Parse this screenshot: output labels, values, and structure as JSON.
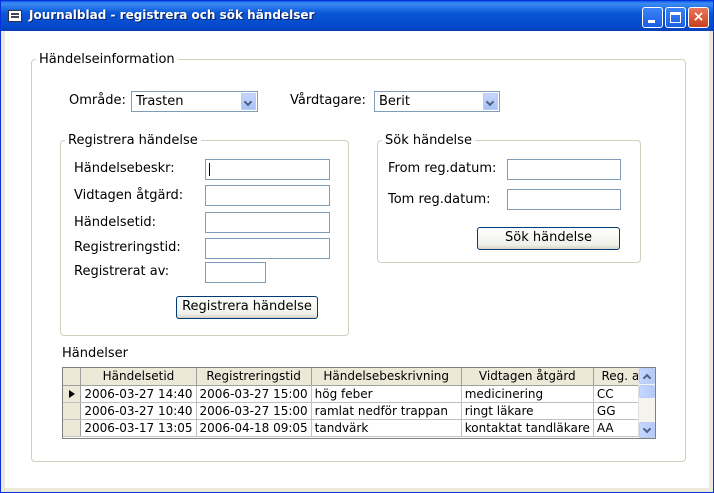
{
  "window": {
    "title": "Journalblad - registrera och sök händelser",
    "close_glyph": "×"
  },
  "info": {
    "legend": "Händelseinformation",
    "area_label": "Område:",
    "area_value": "Trasten",
    "patient_label": "Vårdtagare:",
    "patient_value": "Berit"
  },
  "register": {
    "legend": "Registrera händelse",
    "description_label": "Händelsebeskr:",
    "action_label": "Vidtagen åtgärd:",
    "event_time_label": "Händelsetid:",
    "reg_time_label": "Registreringstid:",
    "reg_by_label": "Registrerat av:",
    "button": "Registrera händelse"
  },
  "search": {
    "legend": "Sök händelse",
    "from_label": "From reg.datum:",
    "to_label": "Tom reg.datum:",
    "button": "Sök händelse"
  },
  "events": {
    "title": "Händelser",
    "columns": [
      "Händelsetid",
      "Registreringstid",
      "Händelsebeskrivning",
      "Vidtagen åtgärd",
      "Reg. av"
    ],
    "rows": [
      [
        "2006-03-27 14:40",
        "2006-03-27 15:00",
        "hög feber",
        "medicinering",
        "CC"
      ],
      [
        "2006-03-27 10:40",
        "2006-03-27 15:00",
        "ramlat nedför trappan",
        "ringt läkare",
        "GG"
      ],
      [
        "2006-03-17 13:05",
        "2006-04-18 09:05",
        "tandvärk",
        "kontaktat tandläkare",
        "AA"
      ]
    ]
  }
}
